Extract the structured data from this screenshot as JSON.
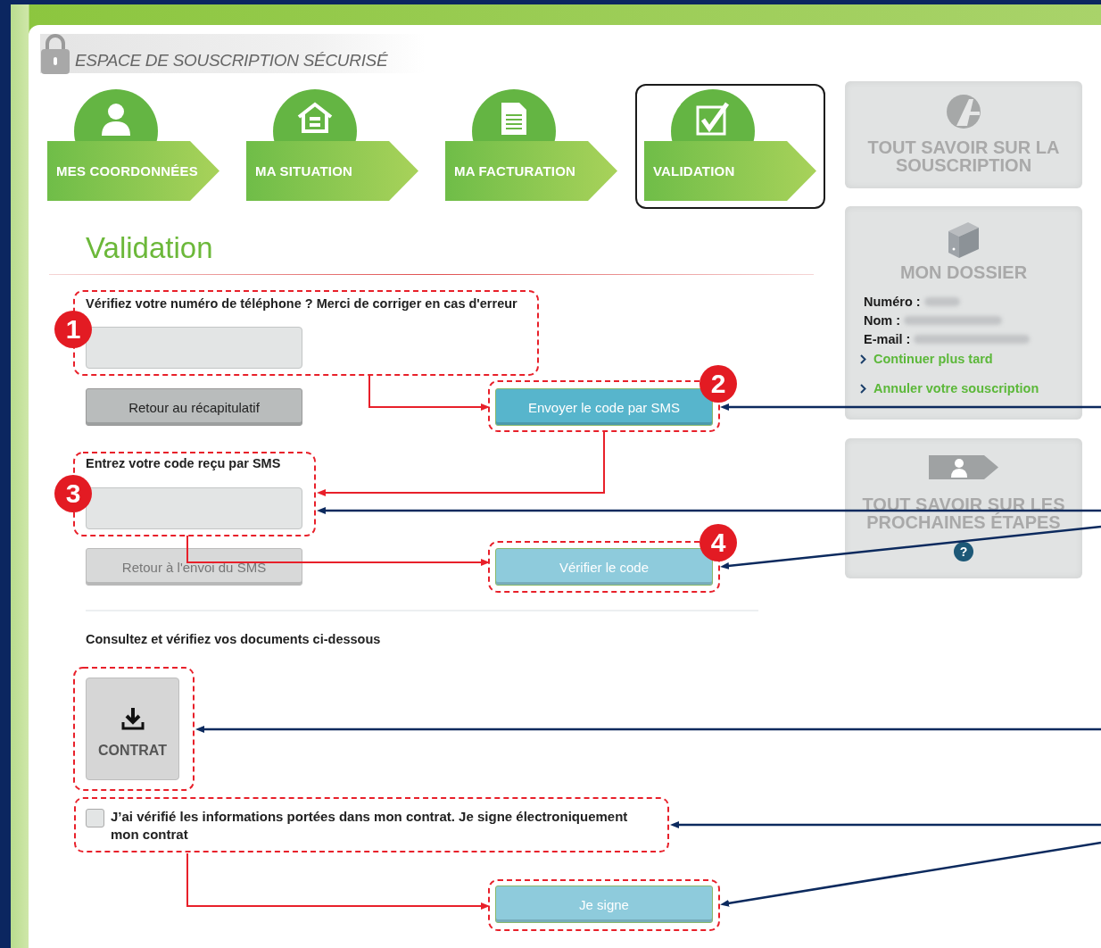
{
  "header": {
    "title": "ESPACE DE SOUSCRIPTION SÉCURISÉ"
  },
  "steps": [
    {
      "label": "MES COORDONNÉES",
      "kind": "user",
      "selected": false
    },
    {
      "label": "MA SITUATION",
      "kind": "house",
      "selected": false
    },
    {
      "label": "MA FACTURATION",
      "kind": "document",
      "selected": false
    },
    {
      "label": "VALIDATION",
      "kind": "checkbox",
      "selected": true
    }
  ],
  "page_title": "Validation",
  "phone_section": {
    "label": "Vérifiez votre numéro de téléphone ? Merci de corriger en cas d'erreur",
    "back_button": "Retour au récapitulatif",
    "send_button": {
      "label": "Envoyer le code par SMS",
      "disabled": false
    }
  },
  "code_section": {
    "label": "Entrez votre code reçu par SMS",
    "back_button": {
      "label": "Retour à l'envoi du SMS",
      "disabled": true
    },
    "verify_button": {
      "label": "Vérifier le code",
      "disabled": true
    }
  },
  "documents": {
    "label": "Consultez et vérifiez vos documents ci-dessous",
    "contract_button": "CONTRAT"
  },
  "consent": {
    "text": "J’ai vérifié les informations portées dans mon contrat. Je signe électroniquement mon contrat",
    "checked": false
  },
  "sign_button": {
    "label": "Je signe",
    "disabled": true
  },
  "sidebar": {
    "about_card": {
      "title": "TOUT SAVOIR SUR LA SOUSCRIPTION"
    },
    "dossier": {
      "title": "MON DOSSIER",
      "fields": [
        {
          "label": "Numéro :"
        },
        {
          "label": "Nom :"
        },
        {
          "label": "E-mail :"
        }
      ],
      "links": [
        "Continuer plus tard",
        "Annuler votre souscription"
      ]
    },
    "next_steps": {
      "title": "TOUT SAVOIR SUR LES PROCHAINES ÉTAPES",
      "help": "?"
    }
  },
  "annotations": {
    "markers": [
      "1",
      "2",
      "3",
      "4"
    ]
  }
}
